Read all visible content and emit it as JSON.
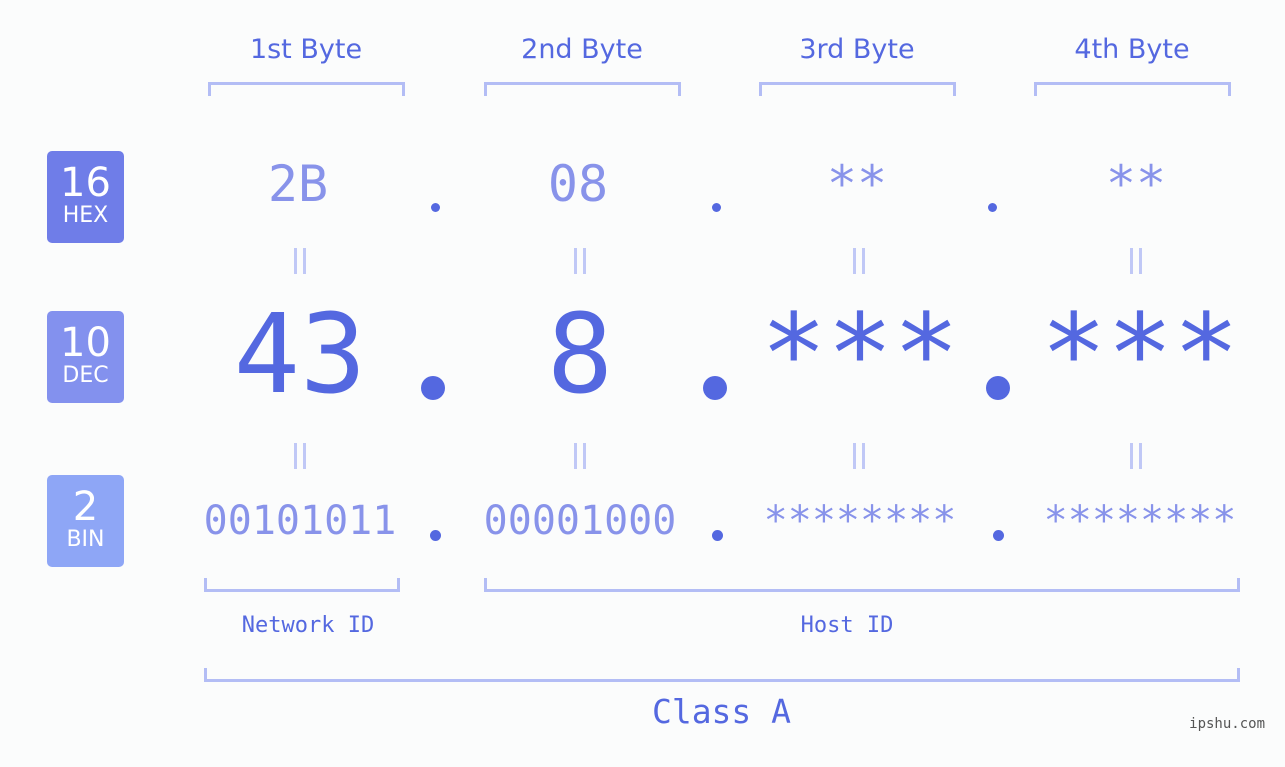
{
  "bytes": {
    "headers": [
      "1st Byte",
      "2nd Byte",
      "3rd Byte",
      "4th Byte"
    ]
  },
  "badges": {
    "hex": {
      "number": "16",
      "label": "HEX",
      "color": "#6f7de8"
    },
    "dec": {
      "number": "10",
      "label": "DEC",
      "color": "#8391ee"
    },
    "bin": {
      "number": "2",
      "label": "BIN",
      "color": "#8ea6f6"
    }
  },
  "rows": {
    "hex": [
      "2B",
      "08",
      "**",
      "**"
    ],
    "dec": [
      "43",
      "8",
      "***",
      "***"
    ],
    "bin": [
      "00101011",
      "00001000",
      "********",
      "********"
    ]
  },
  "separator": ".",
  "equals_symbol": "=",
  "ids": {
    "network": "Network ID",
    "host": "Host ID"
  },
  "class_label": "Class A",
  "watermark": "ipshu.com",
  "colors": {
    "accent": "#5468e0",
    "light_text": "#8893ea",
    "bracket": "#b3bdf5",
    "background": "#fbfcfc"
  }
}
